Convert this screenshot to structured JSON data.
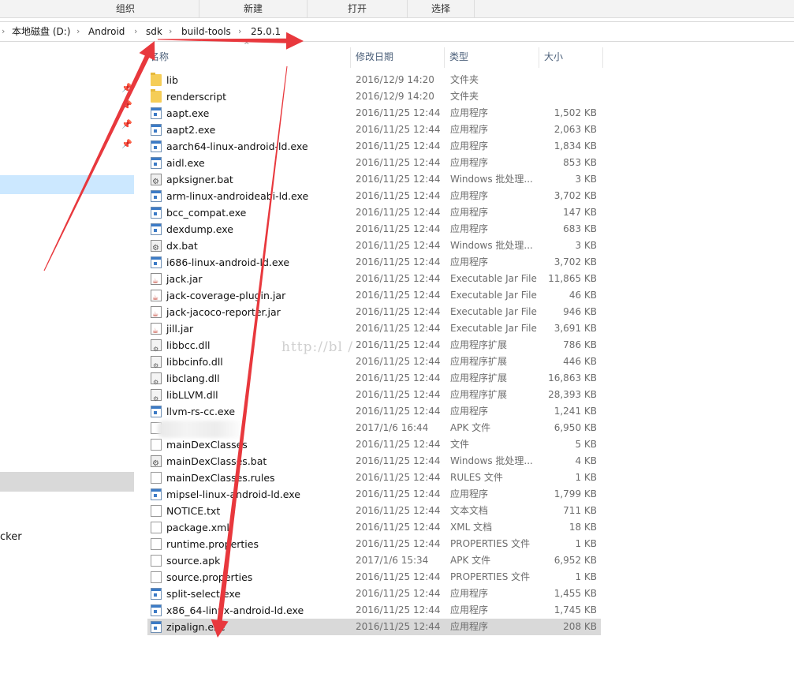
{
  "ribbon": {
    "groups": [
      "组织",
      "新建",
      "打开",
      "选择"
    ]
  },
  "address": {
    "crumbs": [
      "本地磁盘 (D:)",
      "Android",
      "sdk",
      "build-tools",
      "25.0.1"
    ]
  },
  "nav": {
    "partial_text": "cker"
  },
  "columns": {
    "name": "名称",
    "date": "修改日期",
    "type": "类型",
    "size": "大小"
  },
  "files": [
    {
      "name": "lib",
      "date": "2016/12/9 14:20",
      "type": "文件夹",
      "size": "",
      "icon": "folder-icon"
    },
    {
      "name": "renderscript",
      "date": "2016/12/9 14:20",
      "type": "文件夹",
      "size": "",
      "icon": "folder-icon"
    },
    {
      "name": "aapt.exe",
      "date": "2016/11/25 12:44",
      "type": "应用程序",
      "size": "1,502 KB",
      "icon": "exe-icon"
    },
    {
      "name": "aapt2.exe",
      "date": "2016/11/25 12:44",
      "type": "应用程序",
      "size": "2,063 KB",
      "icon": "exe-icon"
    },
    {
      "name": "aarch64-linux-android-ld.exe",
      "date": "2016/11/25 12:44",
      "type": "应用程序",
      "size": "1,834 KB",
      "icon": "exe-icon"
    },
    {
      "name": "aidl.exe",
      "date": "2016/11/25 12:44",
      "type": "应用程序",
      "size": "853 KB",
      "icon": "exe-icon"
    },
    {
      "name": "apksigner.bat",
      "date": "2016/11/25 12:44",
      "type": "Windows 批处理...",
      "size": "3 KB",
      "icon": "bat-icon"
    },
    {
      "name": "arm-linux-androideabi-ld.exe",
      "date": "2016/11/25 12:44",
      "type": "应用程序",
      "size": "3,702 KB",
      "icon": "exe-icon"
    },
    {
      "name": "bcc_compat.exe",
      "date": "2016/11/25 12:44",
      "type": "应用程序",
      "size": "147 KB",
      "icon": "exe-icon"
    },
    {
      "name": "dexdump.exe",
      "date": "2016/11/25 12:44",
      "type": "应用程序",
      "size": "683 KB",
      "icon": "exe-icon"
    },
    {
      "name": "dx.bat",
      "date": "2016/11/25 12:44",
      "type": "Windows 批处理...",
      "size": "3 KB",
      "icon": "bat-icon"
    },
    {
      "name": "i686-linux-android-ld.exe",
      "date": "2016/11/25 12:44",
      "type": "应用程序",
      "size": "3,702 KB",
      "icon": "exe-icon"
    },
    {
      "name": "jack.jar",
      "date": "2016/11/25 12:44",
      "type": "Executable Jar File",
      "size": "11,865 KB",
      "icon": "jar-icon"
    },
    {
      "name": "jack-coverage-plugin.jar",
      "date": "2016/11/25 12:44",
      "type": "Executable Jar File",
      "size": "46 KB",
      "icon": "jar-icon"
    },
    {
      "name": "jack-jacoco-reporter.jar",
      "date": "2016/11/25 12:44",
      "type": "Executable Jar File",
      "size": "946 KB",
      "icon": "jar-icon"
    },
    {
      "name": "jill.jar",
      "date": "2016/11/25 12:44",
      "type": "Executable Jar File",
      "size": "3,691 KB",
      "icon": "jar-icon"
    },
    {
      "name": "libbcc.dll",
      "date": "2016/11/25 12:44",
      "type": "应用程序扩展",
      "size": "786 KB",
      "icon": "dll-icon"
    },
    {
      "name": "libbcinfo.dll",
      "date": "2016/11/25 12:44",
      "type": "应用程序扩展",
      "size": "446 KB",
      "icon": "dll-icon"
    },
    {
      "name": "libclang.dll",
      "date": "2016/11/25 12:44",
      "type": "应用程序扩展",
      "size": "16,863 KB",
      "icon": "dll-icon"
    },
    {
      "name": "libLLVM.dll",
      "date": "2016/11/25 12:44",
      "type": "应用程序扩展",
      "size": "28,393 KB",
      "icon": "dll-icon"
    },
    {
      "name": "llvm-rs-cc.exe",
      "date": "2016/11/25 12:44",
      "type": "应用程序",
      "size": "1,241 KB",
      "icon": "exe-icon"
    },
    {
      "name": "n.apk",
      "date": "2017/1/6 16:44",
      "type": "APK 文件",
      "size": "6,950 KB",
      "icon": "file-icon"
    },
    {
      "name": "mainDexClasses",
      "date": "2016/11/25 12:44",
      "type": "文件",
      "size": "5 KB",
      "icon": "file-icon"
    },
    {
      "name": "mainDexClasses.bat",
      "date": "2016/11/25 12:44",
      "type": "Windows 批处理...",
      "size": "4 KB",
      "icon": "bat-icon"
    },
    {
      "name": "mainDexClasses.rules",
      "date": "2016/11/25 12:44",
      "type": "RULES 文件",
      "size": "1 KB",
      "icon": "file-icon"
    },
    {
      "name": "mipsel-linux-android-ld.exe",
      "date": "2016/11/25 12:44",
      "type": "应用程序",
      "size": "1,799 KB",
      "icon": "exe-icon"
    },
    {
      "name": "NOTICE.txt",
      "date": "2016/11/25 12:44",
      "type": "文本文档",
      "size": "711 KB",
      "icon": "file-icon"
    },
    {
      "name": "package.xml",
      "date": "2016/11/25 12:44",
      "type": "XML 文档",
      "size": "18 KB",
      "icon": "file-icon"
    },
    {
      "name": "runtime.properties",
      "date": "2016/11/25 12:44",
      "type": "PROPERTIES 文件",
      "size": "1 KB",
      "icon": "file-icon"
    },
    {
      "name": "source.apk",
      "date": "2017/1/6 15:34",
      "type": "APK 文件",
      "size": "6,952 KB",
      "icon": "file-icon"
    },
    {
      "name": "source.properties",
      "date": "2016/11/25 12:44",
      "type": "PROPERTIES 文件",
      "size": "1 KB",
      "icon": "file-icon"
    },
    {
      "name": "split-select.exe",
      "date": "2016/11/25 12:44",
      "type": "应用程序",
      "size": "1,455 KB",
      "icon": "exe-icon"
    },
    {
      "name": "x86_64-linux-android-ld.exe",
      "date": "2016/11/25 12:44",
      "type": "应用程序",
      "size": "1,745 KB",
      "icon": "exe-icon"
    },
    {
      "name": "zipalign.exe",
      "date": "2016/11/25 12:44",
      "type": "应用程序",
      "size": "208 KB",
      "icon": "exe-icon",
      "selected": true
    }
  ],
  "watermark": "http://bl                    /",
  "annotation_color": "#e8383d"
}
